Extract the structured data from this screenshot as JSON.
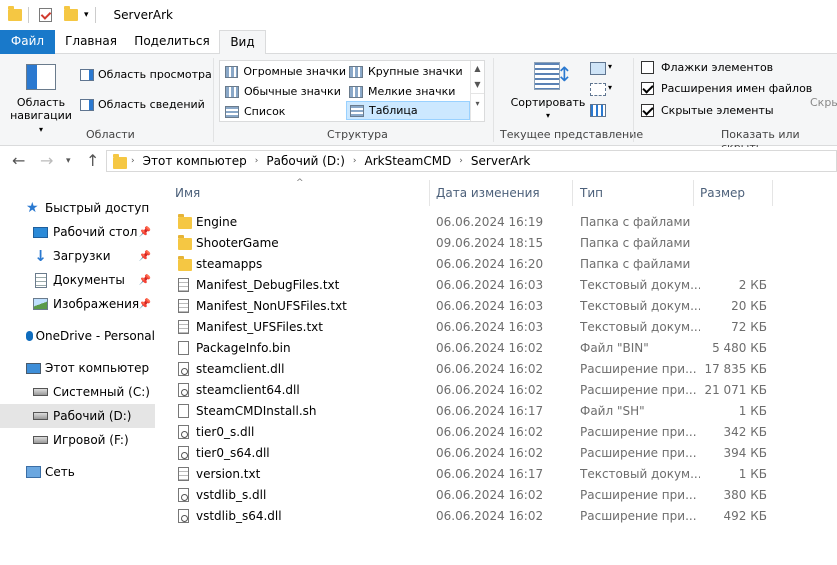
{
  "window": {
    "title": "ServerArk"
  },
  "tabs": {
    "file": "Файл",
    "home": "Главная",
    "share": "Поделиться",
    "view": "Вид"
  },
  "ribbon": {
    "panes": {
      "nav_pane_line1": "Область",
      "nav_pane_line2": "навигации",
      "preview": "Область просмотра",
      "details": "Область сведений",
      "label": "Области"
    },
    "layout": {
      "items": [
        "Огромные значки",
        "Крупные значки",
        "Обычные значки",
        "Мелкие значки",
        "Список",
        "Таблица"
      ],
      "selected": "Таблица",
      "label": "Структура"
    },
    "current_view": {
      "sort": "Сортировать",
      "label": "Текущее представление"
    },
    "show_hide": {
      "item_checkboxes": "Флажки элементов",
      "file_extensions": "Расширения имен файлов",
      "hidden_items": "Скрытые элементы",
      "item_checkboxes_checked": false,
      "file_extensions_checked": true,
      "hidden_items_checked": true,
      "hide_cut": "Скры",
      "label": "Показать или скрыть"
    }
  },
  "address": {
    "crumbs": [
      "Этот компьютер",
      "Рабочий (D:)",
      "ArkSteamCMD",
      "ServerArk"
    ]
  },
  "sidebar": {
    "quick_access": "Быстрый доступ",
    "desktop": "Рабочий стол",
    "downloads": "Загрузки",
    "documents": "Документы",
    "pictures": "Изображения",
    "onedrive": "OneDrive - Personal",
    "this_pc": "Этот компьютер",
    "drive_c": "Системный (C:)",
    "drive_d": "Рабочий (D:)",
    "drive_f": "Игровой (F:)",
    "network": "Сеть"
  },
  "columns": {
    "name": "Имя",
    "date": "Дата изменения",
    "type": "Тип",
    "size": "Размер"
  },
  "files": [
    {
      "name": "Engine",
      "date": "06.06.2024 16:19",
      "type": "Папка с файлами",
      "size": "",
      "icon": "folder"
    },
    {
      "name": "ShooterGame",
      "date": "09.06.2024 18:15",
      "type": "Папка с файлами",
      "size": "",
      "icon": "folder"
    },
    {
      "name": "steamapps",
      "date": "06.06.2024 16:20",
      "type": "Папка с файлами",
      "size": "",
      "icon": "folder"
    },
    {
      "name": "Manifest_DebugFiles.txt",
      "date": "06.06.2024 16:03",
      "type": "Текстовый докум...",
      "size": "2 КБ",
      "icon": "txt"
    },
    {
      "name": "Manifest_NonUFSFiles.txt",
      "date": "06.06.2024 16:03",
      "type": "Текстовый докум...",
      "size": "20 КБ",
      "icon": "txt"
    },
    {
      "name": "Manifest_UFSFiles.txt",
      "date": "06.06.2024 16:03",
      "type": "Текстовый докум...",
      "size": "72 КБ",
      "icon": "txt"
    },
    {
      "name": "PackageInfo.bin",
      "date": "06.06.2024 16:02",
      "type": "Файл \"BIN\"",
      "size": "5 480 КБ",
      "icon": "bin"
    },
    {
      "name": "steamclient.dll",
      "date": "06.06.2024 16:02",
      "type": "Расширение при...",
      "size": "17 835 КБ",
      "icon": "dll"
    },
    {
      "name": "steamclient64.dll",
      "date": "06.06.2024 16:02",
      "type": "Расширение при...",
      "size": "21 071 КБ",
      "icon": "dll"
    },
    {
      "name": "SteamCMDInstall.sh",
      "date": "06.06.2024 16:17",
      "type": "Файл \"SH\"",
      "size": "1 КБ",
      "icon": "bin"
    },
    {
      "name": "tier0_s.dll",
      "date": "06.06.2024 16:02",
      "type": "Расширение при...",
      "size": "342 КБ",
      "icon": "dll"
    },
    {
      "name": "tier0_s64.dll",
      "date": "06.06.2024 16:02",
      "type": "Расширение при...",
      "size": "394 КБ",
      "icon": "dll"
    },
    {
      "name": "version.txt",
      "date": "06.06.2024 16:17",
      "type": "Текстовый докум...",
      "size": "1 КБ",
      "icon": "txt"
    },
    {
      "name": "vstdlib_s.dll",
      "date": "06.06.2024 16:02",
      "type": "Расширение при...",
      "size": "380 КБ",
      "icon": "dll"
    },
    {
      "name": "vstdlib_s64.dll",
      "date": "06.06.2024 16:02",
      "type": "Расширение при...",
      "size": "492 КБ",
      "icon": "dll"
    }
  ]
}
